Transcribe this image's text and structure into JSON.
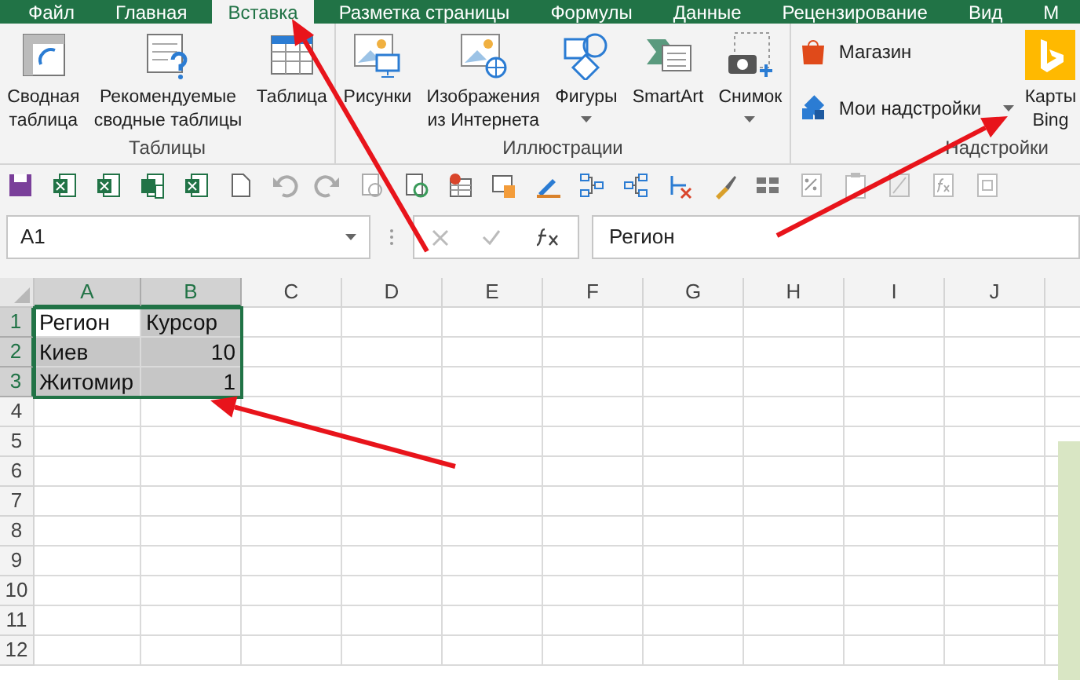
{
  "tabs": [
    {
      "label": "Файл",
      "selected": false
    },
    {
      "label": "Главная",
      "selected": false
    },
    {
      "label": "Вставка",
      "selected": true
    },
    {
      "label": "Разметка страницы",
      "selected": false
    },
    {
      "label": "Формулы",
      "selected": false
    },
    {
      "label": "Данные",
      "selected": false
    },
    {
      "label": "Рецензирование",
      "selected": false
    },
    {
      "label": "Вид",
      "selected": false
    },
    {
      "label": "М",
      "selected": false
    }
  ],
  "ribbon": {
    "groups": [
      {
        "title": "Таблицы",
        "buttons": [
          {
            "kind": "large",
            "label": "Сводная\nтаблица",
            "has_menu": false
          },
          {
            "kind": "large",
            "label": "Рекомендуемые\nсводные таблицы",
            "has_menu": false
          },
          {
            "kind": "large",
            "label": "Таблица",
            "has_menu": false
          }
        ]
      },
      {
        "title": "Иллюстрации",
        "buttons": [
          {
            "kind": "large",
            "label": "Рисунки",
            "has_menu": false
          },
          {
            "kind": "large",
            "label": "Изображения\nиз Интернета",
            "has_menu": false
          },
          {
            "kind": "large",
            "label": "Фигуры",
            "has_menu": true
          },
          {
            "kind": "large",
            "label": "SmartArt",
            "has_menu": false
          },
          {
            "kind": "large",
            "label": "Снимок",
            "has_menu": true
          }
        ]
      },
      {
        "title": "Надстройки",
        "buttons": [
          {
            "kind": "small",
            "label": "Магазин",
            "has_menu": false
          },
          {
            "kind": "small",
            "label": "Мои надстройки",
            "has_menu": true
          },
          {
            "kind": "large",
            "label": "Карты\nBing",
            "has_menu": false
          }
        ]
      }
    ]
  },
  "formula_bar": {
    "name_box": "A1",
    "formula": "Регион"
  },
  "sheet": {
    "columns": [
      {
        "label": "A",
        "selected": true
      },
      {
        "label": "B",
        "selected": true
      },
      {
        "label": "C",
        "selected": false
      },
      {
        "label": "D",
        "selected": false
      },
      {
        "label": "E",
        "selected": false
      },
      {
        "label": "F",
        "selected": false
      },
      {
        "label": "G",
        "selected": false
      },
      {
        "label": "H",
        "selected": false
      },
      {
        "label": "I",
        "selected": false
      },
      {
        "label": "J",
        "selected": false
      }
    ],
    "rows": [
      {
        "label": "1",
        "selected": true,
        "cells": [
          {
            "text": "Регион",
            "kind": "text",
            "selected": true,
            "active": true
          },
          {
            "text": "Курсор",
            "kind": "text",
            "selected": true,
            "active": false
          }
        ]
      },
      {
        "label": "2",
        "selected": true,
        "cells": [
          {
            "text": "Киев",
            "kind": "text",
            "selected": true,
            "active": false
          },
          {
            "text": "10",
            "kind": "number",
            "selected": true,
            "active": false
          }
        ]
      },
      {
        "label": "3",
        "selected": true,
        "cells": [
          {
            "text": "Житомир",
            "kind": "text",
            "selected": true,
            "active": false
          },
          {
            "text": "1",
            "kind": "number",
            "selected": true,
            "active": false
          }
        ]
      },
      {
        "label": "4",
        "selected": false
      },
      {
        "label": "5",
        "selected": false
      },
      {
        "label": "6",
        "selected": false
      },
      {
        "label": "7",
        "selected": false
      },
      {
        "label": "8",
        "selected": false
      },
      {
        "label": "9",
        "selected": false
      },
      {
        "label": "10",
        "selected": false
      },
      {
        "label": "11",
        "selected": false
      },
      {
        "label": "12",
        "selected": false
      }
    ]
  }
}
